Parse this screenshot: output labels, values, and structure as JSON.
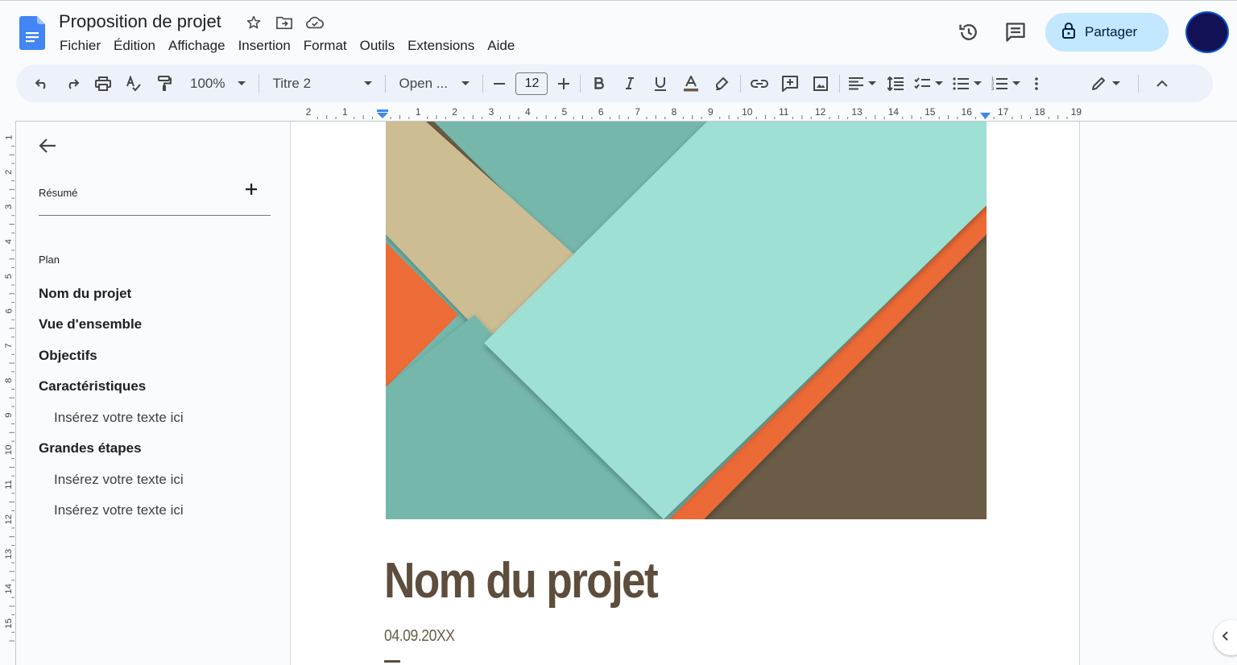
{
  "app": {
    "doc_title": "Proposition de projet",
    "menus": [
      "Fichier",
      "Édition",
      "Affichage",
      "Insertion",
      "Format",
      "Outils",
      "Extensions",
      "Aide"
    ],
    "share_label": "Partager"
  },
  "toolbar": {
    "zoom": "100%",
    "style": "Titre 2",
    "font": "Open ...",
    "font_size": "12"
  },
  "ruler": {
    "h_labels": [
      "2",
      "1",
      "",
      "1",
      "2",
      "3",
      "4",
      "5",
      "6",
      "7",
      "8",
      "9",
      "10",
      "11",
      "12",
      "13",
      "14",
      "15",
      "16",
      "17",
      "18",
      "19"
    ],
    "v_labels": [
      "1",
      "2",
      "3",
      "4",
      "5",
      "6",
      "7",
      "8",
      "9",
      "10",
      "11",
      "12",
      "13",
      "14",
      "15"
    ]
  },
  "sidebar": {
    "summary_label": "Résumé",
    "plan_label": "Plan",
    "outline": [
      {
        "text": "Nom du projet",
        "level": 1
      },
      {
        "text": "Vue d'ensemble",
        "level": 1
      },
      {
        "text": "Objectifs",
        "level": 1
      },
      {
        "text": "Caractéristiques",
        "level": 1
      },
      {
        "text": "Insérez votre texte ici",
        "level": 2
      },
      {
        "text": "Grandes étapes",
        "level": 1
      },
      {
        "text": "Insérez votre texte ici",
        "level": 2
      },
      {
        "text": "Insérez votre texte ici",
        "level": 2
      }
    ]
  },
  "document": {
    "title": "Nom du projet",
    "date": "04.09.20XX"
  },
  "colors": {
    "accent_blue": "#0b57d0",
    "share_bg": "#c2e7ff",
    "toolbar_bg": "#edf2fa",
    "hero_teal": "#75b8ab",
    "hero_mint": "#9ee0d3",
    "hero_tan": "#cdbd93",
    "hero_orange": "#ec6b36",
    "hero_brown": "#6a5c47",
    "title_brown": "#5c4d3c"
  }
}
